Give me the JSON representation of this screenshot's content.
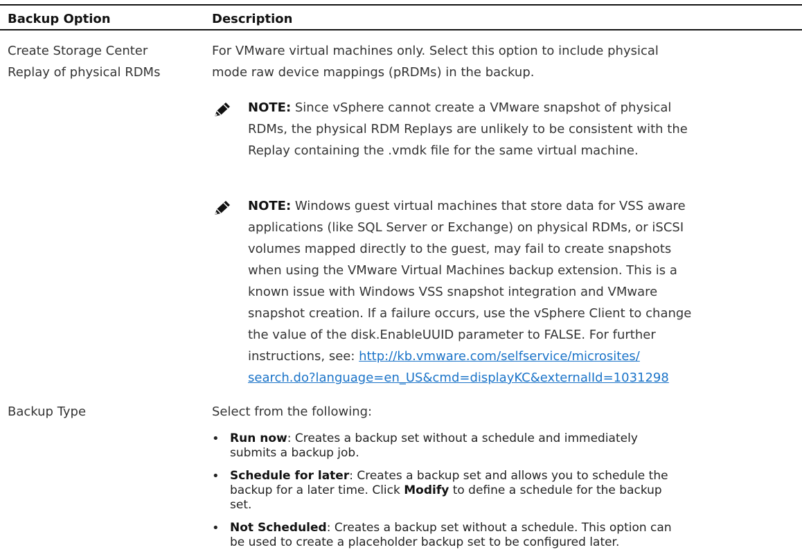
{
  "table": {
    "headers": {
      "option": "Backup Option",
      "description": "Description"
    },
    "row1": {
      "option_line1": "Create Storage Center",
      "option_line2": "Replay of physical RDMs",
      "desc_line1": "For VMware virtual machines only. Select this option to include physical",
      "desc_line2": "mode raw device mappings (pRDMs) in the backup.",
      "note1": {
        "label": "NOTE:",
        "line1": " Since vSphere cannot create a VMware snapshot of physical",
        "line2": "RDMs, the physical RDM Replays are unlikely to be consistent with the",
        "line3": "Replay containing the .vmdk file for the same virtual machine."
      },
      "note2": {
        "label": "NOTE:",
        "line1": " Windows guest virtual machines that store data for VSS aware",
        "line2": "applications (like SQL Server or Exchange) on physical RDMs, or iSCSI",
        "line3": "volumes mapped directly to the guest, may fail to create snapshots",
        "line4": "when using the VMware Virtual Machines backup extension. This is a",
        "line5": "known issue with Windows VSS snapshot integration and VMware",
        "line6": "snapshot creation. If a failure occurs, use the vSphere Client to change",
        "line7": "the value of the disk.EnableUUID parameter to FALSE. For further",
        "line8_prefix": "instructions, see: ",
        "link_line1": "http://kb.vmware.com/selfservice/microsites/",
        "link_line2": "search.do?language=en_US&cmd=displayKC&externalId=1031298"
      }
    },
    "row2": {
      "option": "Backup Type",
      "intro": "Select from the following:",
      "bullets": [
        {
          "bullet": "•",
          "term": "Run now",
          "line1": ": Creates a backup set without a schedule and immediately",
          "line2": "submits a backup job."
        },
        {
          "bullet": "•",
          "term": "Schedule for later",
          "line1": ": Creates a backup set and allows you to schedule the",
          "line2_a": "backup for a later time. Click ",
          "line2_term": "Modify",
          "line2_b": " to define a schedule for the backup",
          "line3": "set."
        },
        {
          "bullet": "•",
          "term": "Not Scheduled",
          "line1": ": Creates a backup set without a schedule. This option can",
          "line2": "be used to create a placeholder backup set to be configured later."
        }
      ]
    }
  },
  "icons": {
    "note_icon": "pencil-note-icon"
  },
  "colors": {
    "link": "#1a73c8",
    "text": "#333333",
    "rule": "#111111"
  }
}
